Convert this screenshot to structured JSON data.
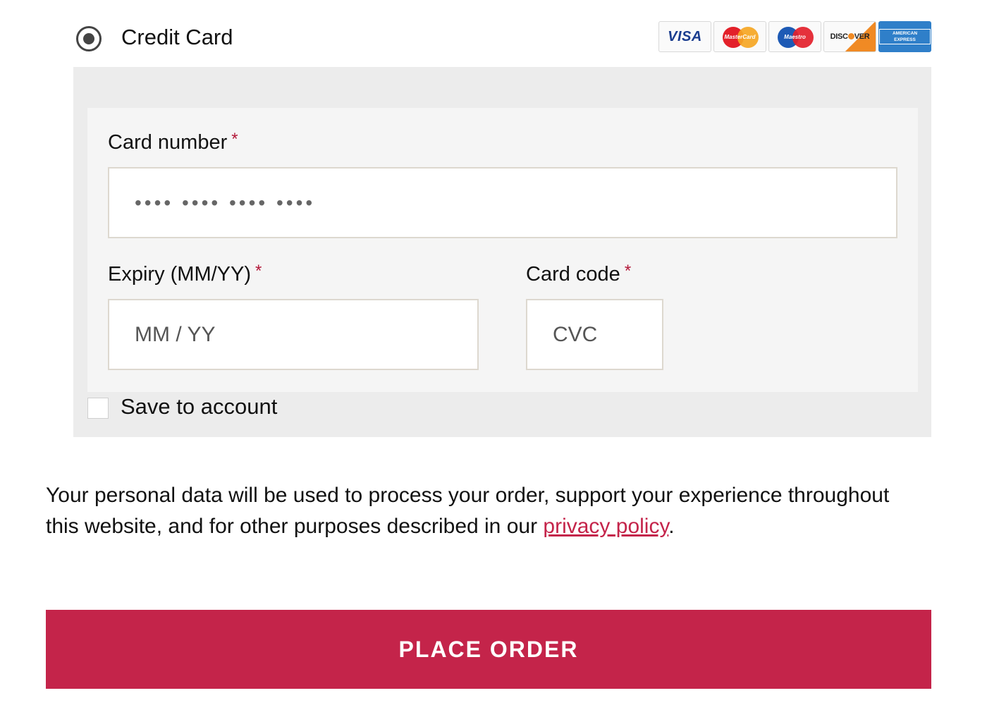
{
  "payment_method": {
    "label": "Credit Card",
    "selected": true,
    "card_logos": [
      {
        "icon": "visa-logo-icon",
        "text": "VISA"
      },
      {
        "icon": "mastercard-logo-icon",
        "text": "MasterCard"
      },
      {
        "icon": "maestro-logo-icon",
        "text": "Maestro"
      },
      {
        "icon": "discover-logo-icon",
        "text": "DISCOVER"
      },
      {
        "icon": "amex-logo-icon",
        "text": "AMERICAN EXPRESS"
      }
    ]
  },
  "card_form": {
    "card_number": {
      "label": "Card number",
      "required_marker": "*",
      "placeholder": "•••• •••• •••• ••••"
    },
    "expiry": {
      "label": "Expiry (MM/YY)",
      "required_marker": "*",
      "placeholder": "MM / YY"
    },
    "card_code": {
      "label": "Card code",
      "required_marker": "*",
      "placeholder": "CVC"
    },
    "save_to_account": {
      "label": "Save to account",
      "checked": false
    }
  },
  "privacy_notice": {
    "text_before": "Your personal data will be used to process your order, support your experience throughout this website, and for other purposes described in our ",
    "link_text": "privacy policy",
    "text_after": "."
  },
  "place_order": {
    "label": "PLACE ORDER"
  },
  "colors": {
    "accent": "#c4244a",
    "panel_outer": "#ececec",
    "panel_inner": "#f5f5f5"
  }
}
